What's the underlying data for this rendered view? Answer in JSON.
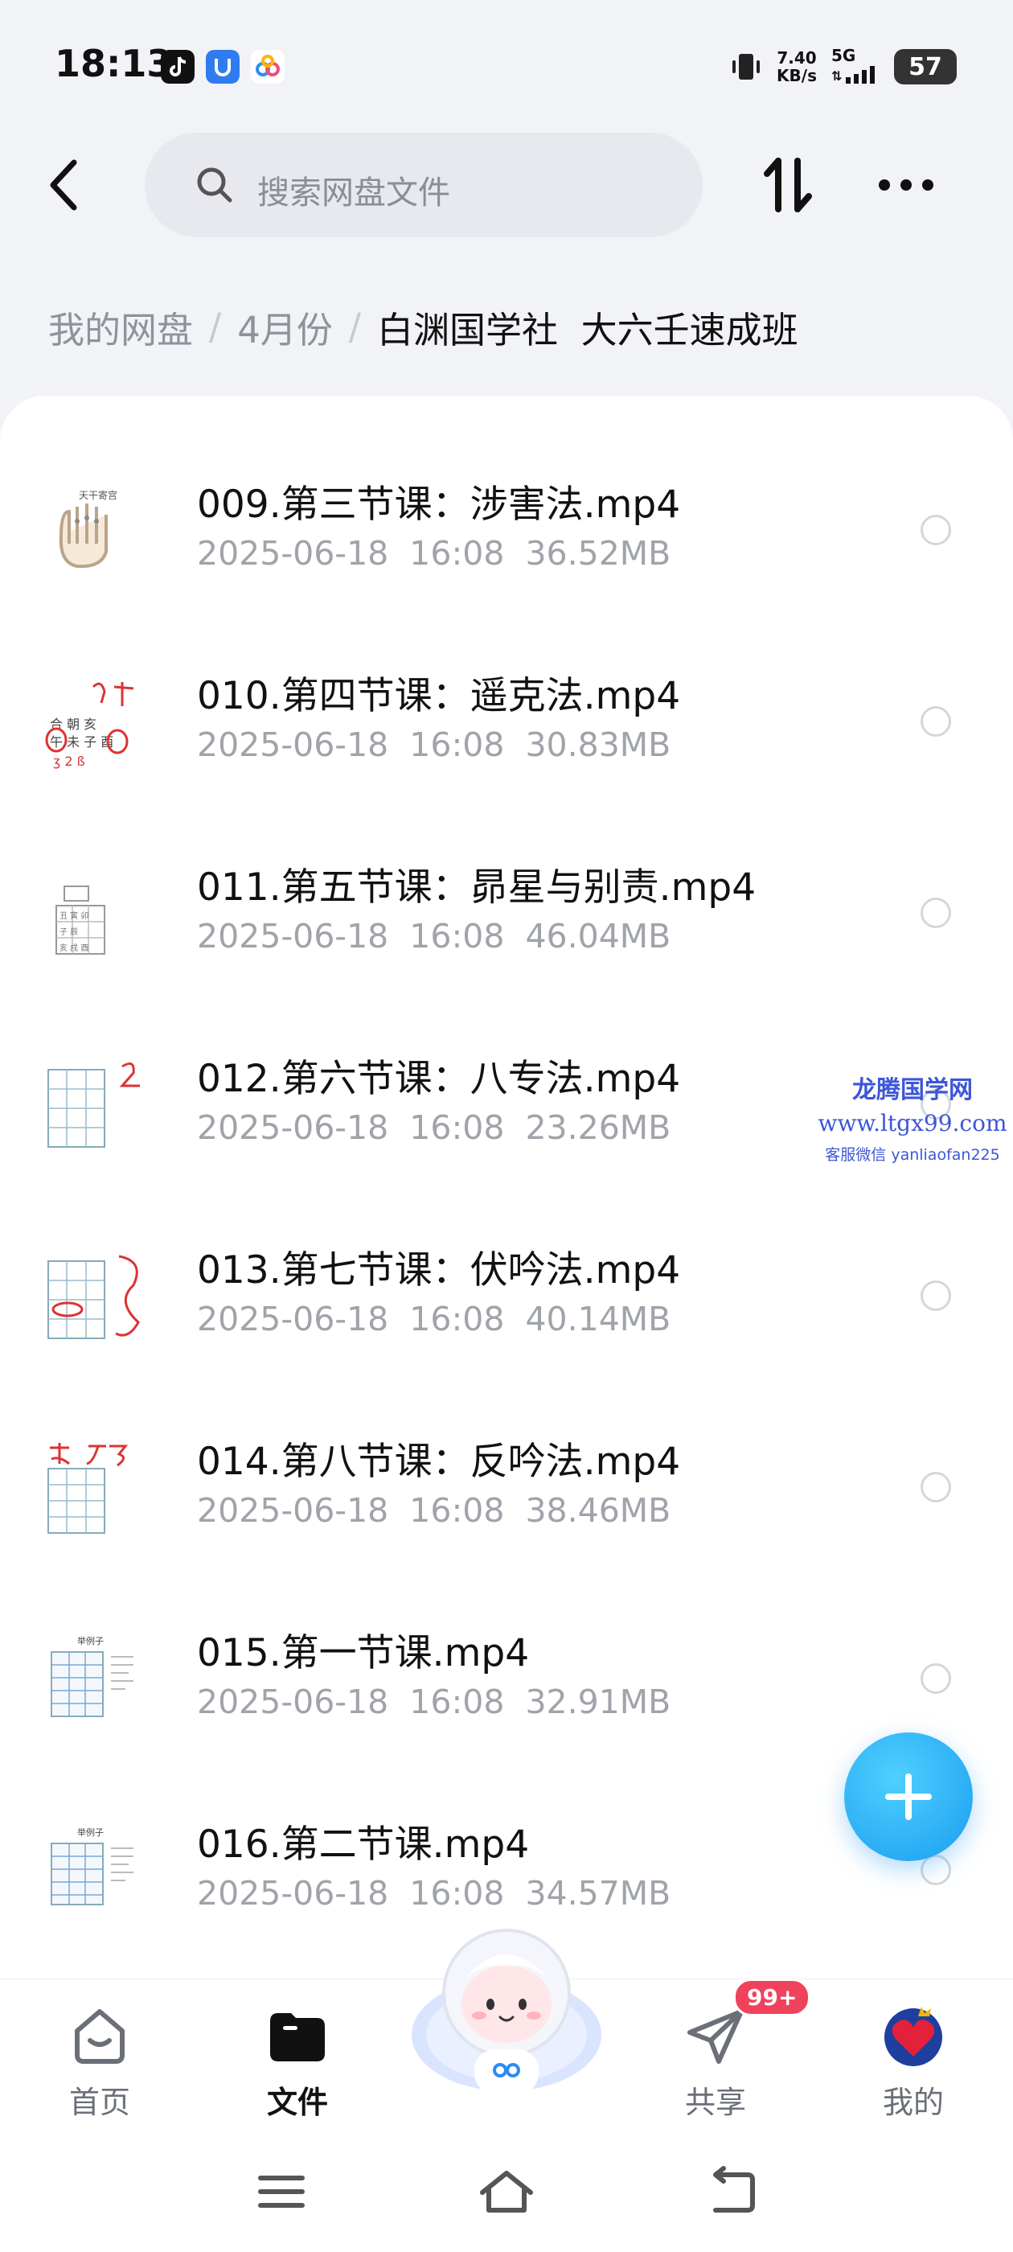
{
  "status_bar": {
    "time": "18:13",
    "speed_value": "7.40",
    "speed_unit": "KB/s",
    "network": "5G",
    "battery": "57",
    "app_icons": [
      "tiktok-icon",
      "u-shield-icon",
      "baidu-netdisk-icon"
    ]
  },
  "header": {
    "search_placeholder": "搜索网盘文件"
  },
  "breadcrumb": {
    "items": [
      "我的网盘",
      "4月份"
    ],
    "current": "白渊国学社  大六壬速成班"
  },
  "files": [
    {
      "name": "009.第三节课：涉害法.mp4",
      "date": "2025-06-18",
      "time": "16:08",
      "size": "36.52MB"
    },
    {
      "name": "010.第四节课：遥克法.mp4",
      "date": "2025-06-18",
      "time": "16:08",
      "size": "30.83MB"
    },
    {
      "name": "011.第五节课：昴星与别责.mp4",
      "date": "2025-06-18",
      "time": "16:08",
      "size": "46.04MB"
    },
    {
      "name": "012.第六节课：八专法.mp4",
      "date": "2025-06-18",
      "time": "16:08",
      "size": "23.26MB"
    },
    {
      "name": "013.第七节课：伏吟法.mp4",
      "date": "2025-06-18",
      "time": "16:08",
      "size": "40.14MB"
    },
    {
      "name": "014.第八节课：反吟法.mp4",
      "date": "2025-06-18",
      "time": "16:08",
      "size": "38.46MB"
    },
    {
      "name": "015.第一节课.mp4",
      "date": "2025-06-18",
      "time": "16:08",
      "size": "32.91MB"
    },
    {
      "name": "016.第二节课.mp4",
      "date": "2025-06-18",
      "time": "16:08",
      "size": "34.57MB"
    }
  ],
  "watermark": {
    "line1": "龙腾国学网",
    "line2": "www.ltgx99.com",
    "line3": "客服微信 yanliaofan225"
  },
  "bottom_nav": {
    "home": "首页",
    "files": "文件",
    "share": "共享",
    "share_badge": "99+",
    "mine": "我的"
  },
  "colors": {
    "accent": "#1a9df0",
    "badge": "#f0425c",
    "muted_text": "#a0a3aa"
  }
}
